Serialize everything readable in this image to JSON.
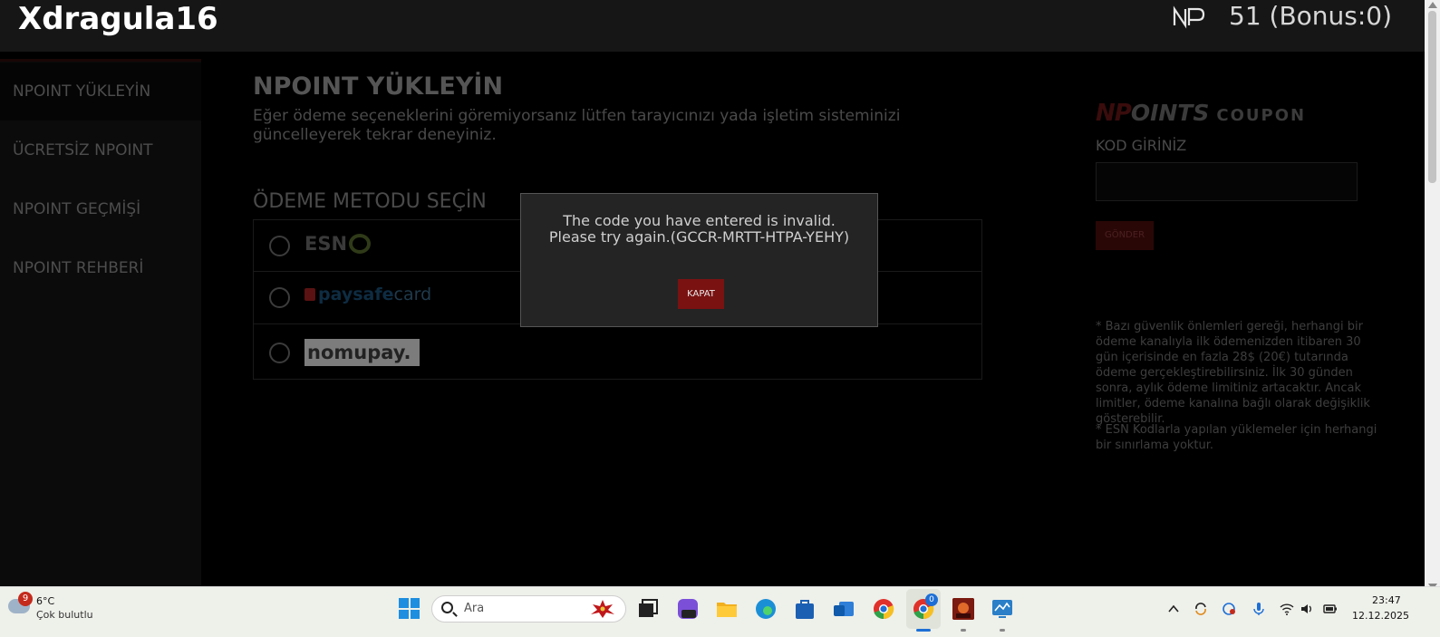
{
  "header": {
    "username": "Xdragula16",
    "balance": "51 (Bonus:0)"
  },
  "sidebar": {
    "items": [
      {
        "label": "NPOINT YÜKLEYİN"
      },
      {
        "label": "ÜCRETSİZ NPOINT"
      },
      {
        "label": "NPOINT GEÇMİŞİ"
      },
      {
        "label": "NPOINT REHBERİ"
      }
    ]
  },
  "main": {
    "title": "NPOINT YÜKLEYİN",
    "description": "Eğer ödeme seçeneklerini göremiyorsanız lütfen tarayıcınızı yada işletim sisteminizi güncelleyerek tekrar deneyiniz.",
    "method_heading": "ÖDEME METODU SEÇİN",
    "methods": [
      {
        "name": "ESN"
      },
      {
        "name": "paysafe",
        "suffix": "card"
      },
      {
        "name": "nomupay."
      }
    ]
  },
  "coupon": {
    "logo_np": "NP",
    "logo_points": "OINTS",
    "logo_word": "COUPON",
    "code_label": "KOD GİRİNİZ",
    "code_value": "",
    "submit_label": "GÖNDER",
    "notes": [
      "* Bazı güvenlik önlemleri gereği, herhangi bir ödeme kanalıyla ilk ödemenizden itibaren 30 gün içerisinde en fazla 28$ (20€) tutarında ödeme gerçekleştirebilirsiniz. İlk 30 günden sonra, aylık ödeme limitiniz artacaktır. Ancak limitler, ödeme kanalına bağlı olarak değişiklik gösterebilir.",
      "* ESN Kodlarla yapılan yüklemeler için herhangi bir sınırlama yoktur."
    ]
  },
  "modal": {
    "line1": "The code you have entered is invalid.",
    "line2": "Please try again.(GCCR-MRTT-HTPA-YEHY)",
    "close_label": "KAPAT"
  },
  "taskbar": {
    "weather_badge": "9",
    "temperature": "6°C",
    "condition": "Çok bulutlu",
    "search_placeholder": "Ara",
    "chrome_badge": "0",
    "time": "23:47",
    "date": "12.12.2025"
  }
}
